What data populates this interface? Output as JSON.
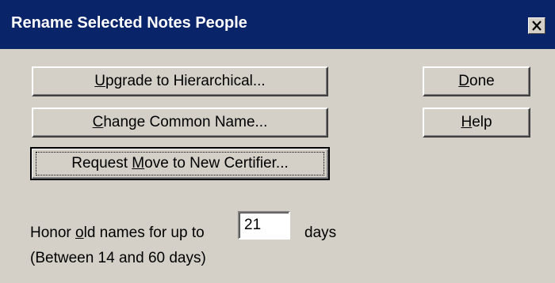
{
  "window": {
    "title": "Rename Selected Notes People"
  },
  "buttons": {
    "upgrade": {
      "pre": "",
      "key": "U",
      "post": "pgrade to Hierarchical..."
    },
    "change_common": {
      "pre": "",
      "key": "C",
      "post": "hange Common Name..."
    },
    "request_move": {
      "pre": "Request ",
      "key": "M",
      "post": "ove to New Certifier..."
    },
    "done": {
      "pre": "",
      "key": "D",
      "post": "one"
    },
    "help": {
      "pre": "",
      "key": "H",
      "post": "elp"
    }
  },
  "honor": {
    "label_pre": "Honor ",
    "label_key": "o",
    "label_post": "ld names for up to",
    "days_value": "21",
    "days_unit": "days",
    "range_hint": "(Between 14 and 60 days)"
  },
  "icons": {
    "close": "close-icon"
  },
  "colors": {
    "titlebar": "#0a246a",
    "face": "#d4d0c8"
  }
}
